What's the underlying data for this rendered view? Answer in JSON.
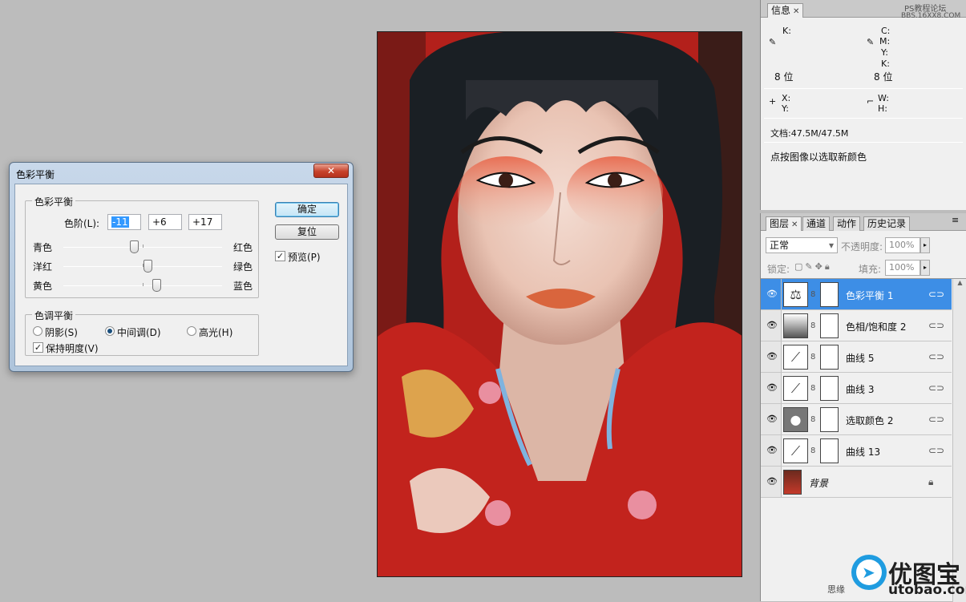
{
  "dialog": {
    "title": "色彩平衡",
    "close_label": "✕",
    "color_balance_group": "色彩平衡",
    "levels_label": "色阶(L):",
    "levels": [
      "-11",
      "+6",
      "+17"
    ],
    "sliders": [
      {
        "left": "青色",
        "right": "红色",
        "value": -11
      },
      {
        "left": "洋红",
        "right": "绿色",
        "value": 6
      },
      {
        "left": "黄色",
        "right": "蓝色",
        "value": 17
      }
    ],
    "tone_group": "色调平衡",
    "tones": [
      "阴影(S)",
      "中间调(D)",
      "高光(H)"
    ],
    "selected_tone": "中间调(D)",
    "preserve_luminosity": "保持明度(V)",
    "ok_label": "确定",
    "reset_label": "复位",
    "preview_label": "预览(P)"
  },
  "info_panel": {
    "tab": "信息",
    "k_label": "K:",
    "c_label": "C:",
    "m_label": "M:",
    "y_label": "Y:",
    "k2_label": "K:",
    "bits_left": "8 位",
    "bits_right": "8 位",
    "x_label": "X:",
    "y2_label": "Y:",
    "w_label": "W:",
    "h_label": "H:",
    "doc_size": "文档:47.5M/47.5M",
    "hint": "点按图像以选取新颜色"
  },
  "layers_panel": {
    "tabs": [
      "图层",
      "通道",
      "动作",
      "历史记录"
    ],
    "blend_mode": "正常",
    "opacity_label": "不透明度:",
    "opacity_value": "100%",
    "lock_label": "锁定:",
    "fill_label": "填充:",
    "fill_value": "100%",
    "layers": [
      {
        "name": "色彩平衡 1",
        "icon": "balance-icon",
        "selected": true
      },
      {
        "name": "色相/饱和度 2",
        "icon": "hue-saturation-icon",
        "selected": false
      },
      {
        "name": "曲线 5",
        "icon": "curves-icon",
        "selected": false
      },
      {
        "name": "曲线 3",
        "icon": "curves-icon",
        "selected": false
      },
      {
        "name": "选取颜色 2",
        "icon": "selective-color-icon",
        "selected": false
      },
      {
        "name": "曲线 13",
        "icon": "curves-icon",
        "selected": false
      },
      {
        "name": "背景",
        "icon": "photo-thumbnail",
        "selected": false
      }
    ]
  },
  "watermarks": {
    "top_right_1": "PS教程论坛",
    "top_right_2": "BBS.16XX8.COM",
    "brand_cn": "优图宝",
    "brand_url": "utobao.com",
    "bottom_text": "思缘"
  },
  "colors": {
    "selection_blue": "#3d8ee6",
    "panel_bg": "#f0f0f0",
    "workspace": "#bcbcbc"
  }
}
